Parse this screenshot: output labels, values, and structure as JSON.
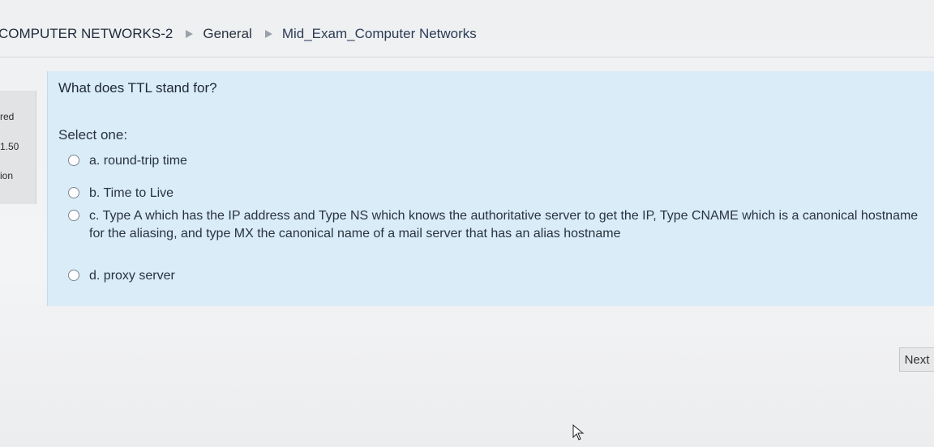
{
  "breadcrumb": {
    "course": "COMPUTER NETWORKS-2",
    "section": "General",
    "quiz": "Mid_Exam_Computer Networks"
  },
  "sidebar": {
    "status_fragment": "red",
    "marks_fragment": "1.50",
    "question_fragment": "ion"
  },
  "question": {
    "text": "What does TTL stand for?",
    "prompt": "Select one:",
    "options": [
      {
        "label": "a. round-trip time"
      },
      {
        "label": "b. Time to Live"
      },
      {
        "label": "c. Type A which has the IP address and Type NS which knows the authoritative server to get the IP, Type CNAME which is a canonical hostname for the aliasing, and type MX the canonical name of a mail server that has an alias hostname"
      },
      {
        "label": "d. proxy server"
      }
    ]
  },
  "nav": {
    "next_label": "Next"
  },
  "icons": {
    "breadcrumb_separator": "triangle-right-icon",
    "cursor": "mouse-pointer-icon"
  }
}
